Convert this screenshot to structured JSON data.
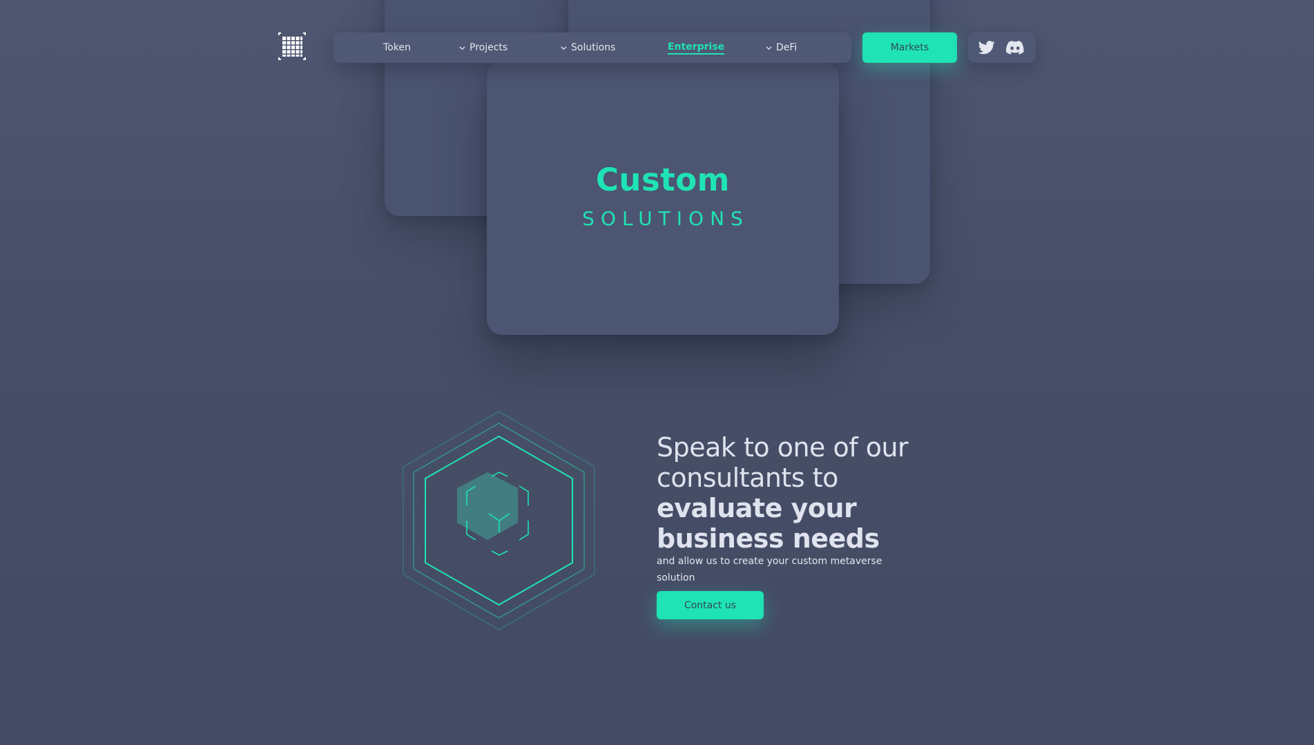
{
  "colors": {
    "accent": "#1fe3b4",
    "background": "#4a5269",
    "card": "#4c5571",
    "text": "#e4e7ef"
  },
  "header": {
    "logo_icon": "grid-logo-icon",
    "nav": [
      {
        "label": "Token",
        "has_dropdown": false,
        "active": false
      },
      {
        "label": "Projects",
        "has_dropdown": true,
        "active": false
      },
      {
        "label": "Solutions",
        "has_dropdown": true,
        "active": false
      },
      {
        "label": "Enterprise",
        "has_dropdown": false,
        "active": true
      },
      {
        "label": "DeFi",
        "has_dropdown": true,
        "active": false
      }
    ],
    "markets_label": "Markets",
    "social": [
      {
        "icon": "twitter-icon"
      },
      {
        "icon": "discord-icon"
      }
    ]
  },
  "hero": {
    "title": "Custom",
    "subtitle": "SOLUTIONS"
  },
  "cta": {
    "graphic_icon": "hexagon-cube-icon",
    "heading_line1": "Speak to one of our",
    "heading_line2": "consultants to",
    "heading_line3": "evaluate your",
    "heading_line4": "business needs",
    "body": "and allow us to create your custom metaverse solution",
    "button_label": "Contact us"
  }
}
